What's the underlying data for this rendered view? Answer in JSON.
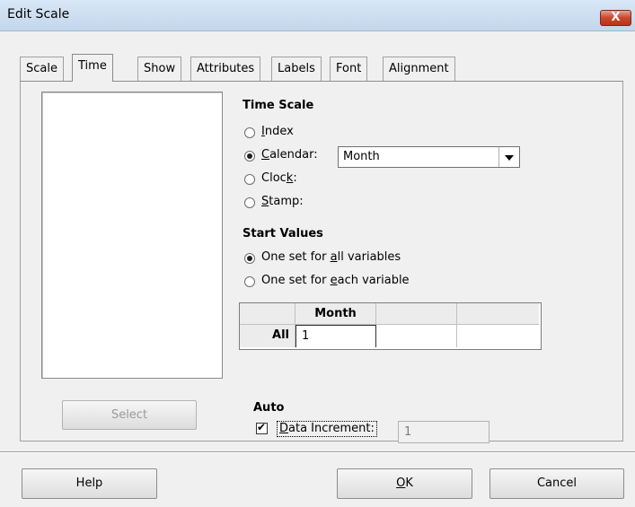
{
  "window": {
    "title": "Edit Scale",
    "close_glyph": "X"
  },
  "tabs": [
    "Scale",
    "Time",
    "Show",
    "Attributes",
    "Labels",
    "Font",
    "Alignment"
  ],
  "active_tab": "Time",
  "left_panel": {
    "select_label": "Select"
  },
  "time_scale": {
    "heading": "Time Scale",
    "options": [
      "Index",
      "Calendar:",
      "Clock:",
      "Stamp:"
    ],
    "selected": "Calendar:",
    "calendar_value": "Month"
  },
  "start_values": {
    "heading": "Start Values",
    "options": [
      "One set for all variables",
      "One set for each variable"
    ],
    "selected": "One set for all variables",
    "table": {
      "columns": [
        "",
        "Month",
        "",
        ""
      ],
      "rows": [
        {
          "label": "All",
          "values": [
            "1",
            "",
            ""
          ]
        }
      ]
    }
  },
  "auto": {
    "heading": "Auto",
    "data_increment_label": "Data Increment:",
    "data_increment_checked": true,
    "data_increment_value": "1"
  },
  "buttons": {
    "help": "Help",
    "ok": "OK",
    "cancel": "Cancel"
  }
}
